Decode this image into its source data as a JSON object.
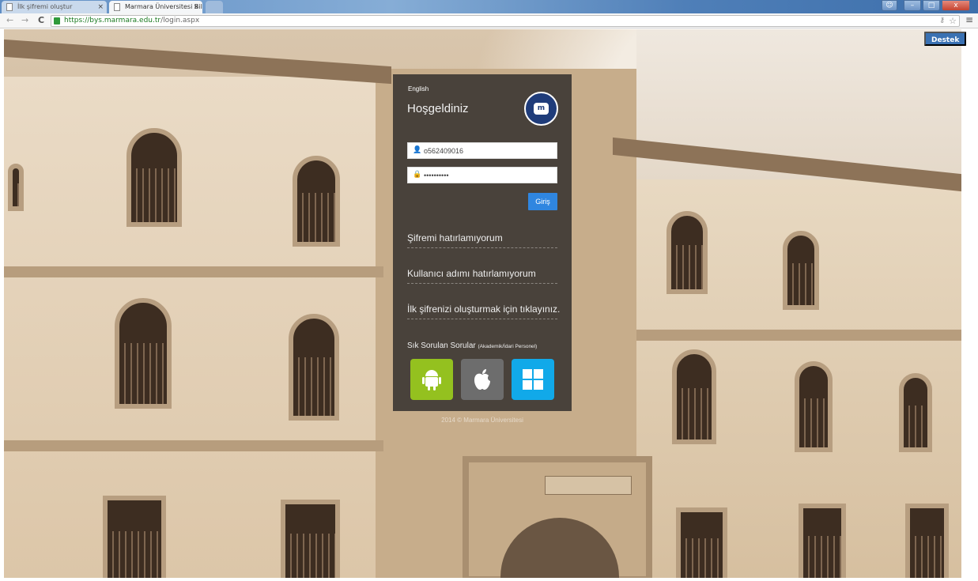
{
  "browser": {
    "tabs": [
      {
        "title": "İlk şifremi oluştur",
        "active": false
      },
      {
        "title": "Marmara Üniversitesi Bilg",
        "active": true
      }
    ],
    "url_domain": "https://bys.marmara.edu.tr",
    "url_path": "/login.aspx",
    "window_buttons": {
      "minimize": "–",
      "maximize": "□",
      "close": "x"
    }
  },
  "page": {
    "support_button": "Destek",
    "login": {
      "language_link": "English",
      "welcome_title": "Hoşgeldiniz",
      "seal_label": "m",
      "username_value": "o562409016",
      "password_value": "••••••••••",
      "submit_label": "Giriş",
      "links": [
        "Şifremi hatırlamıyorum",
        "Kullanıcı adımı hatırlamıyorum",
        "İlk şifrenizi oluşturmak için tıklayınız."
      ],
      "faq_label": "Sık Sorulan Sorular",
      "faq_note": "(Akademik/İdari Personel)",
      "apps": [
        "android-icon",
        "apple-icon",
        "windows-icon"
      ],
      "copyright": "2014 © Marmara Üniversitesi"
    }
  },
  "colors": {
    "panel": "#34302d",
    "submit": "#2f86e0",
    "support": "#3a71b3",
    "android": "#94c11f",
    "apple": "#6d6d6d",
    "windows": "#11a9e9"
  }
}
